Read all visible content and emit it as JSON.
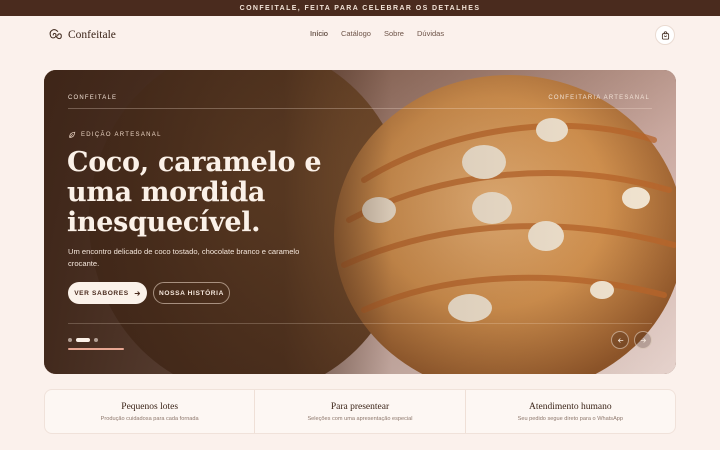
{
  "announcement": "CONFEITALE, FEITA PARA CELEBRAR OS DETALHES",
  "brand": {
    "name": "Confeitale"
  },
  "nav": {
    "items": [
      {
        "label": "Início",
        "active": true
      },
      {
        "label": "Catálogo",
        "active": false
      },
      {
        "label": "Sobre",
        "active": false
      },
      {
        "label": "Dúvidas",
        "active": false
      }
    ]
  },
  "header": {
    "cart_icon": "bag-icon"
  },
  "hero": {
    "label_left": "CONFEITALE",
    "label_right": "CONFEITARIA ARTESANAL",
    "edition": "EDIÇÃO ARTESANAL",
    "headline": "Coco, caramelo e uma mordida inesquecível.",
    "subtitle": "Um encontro delicado de coco tostado, chocolate branco e caramelo crocante.",
    "primary_button": "VER SABORES",
    "secondary_button": "NOSSA HISTÓRIA",
    "slides": {
      "count": 3,
      "active": 1
    },
    "progress_fraction": 0.1,
    "colors": {
      "accent": "#e7a692",
      "dark": "#4a2b1e",
      "cream": "#fbf2ea"
    }
  },
  "features": [
    {
      "title": "Pequenos lotes",
      "description": "Produção cuidadosa para cada fornada"
    },
    {
      "title": "Para presentear",
      "description": "Seleções com uma apresentação especial"
    },
    {
      "title": "Atendimento humano",
      "description": "Seu pedido segue direto para o WhatsApp"
    }
  ]
}
